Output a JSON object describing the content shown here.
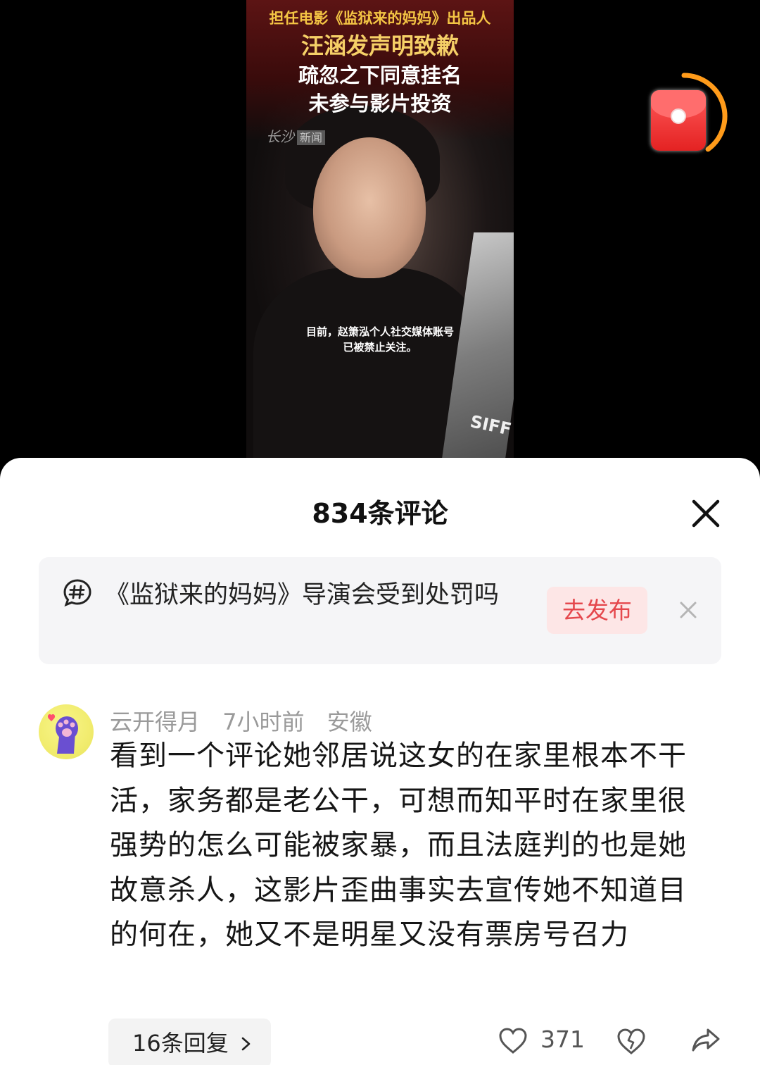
{
  "video": {
    "headline_sub": "担任电影《监狱来的妈妈》出品人",
    "headline_main": "汪涵发声明致歉",
    "headline_line2": "疏忽之下同意挂名",
    "headline_line3": "未参与影片投资",
    "logo_news": "新闻",
    "caption_line1": "目前，赵箫泓个人社交媒体账号",
    "caption_line2": "已被禁止关注。",
    "trophy_text": "SIFF",
    "red_packet_progress": 0.4,
    "accent_orange": "#ff9b1a"
  },
  "sheet": {
    "title": "834条评论",
    "close_icon": "close-icon"
  },
  "topic": {
    "icon": "hashtag-bubble-icon",
    "text": "《监狱来的妈妈》导演会受到处罚吗",
    "publish_label": "去发布",
    "accent": "#e5484d"
  },
  "comment": {
    "author": "云开得月",
    "time": "7小时前",
    "location": "安徽",
    "body": "看到一个评论她邻居说这女的在家里根本不干活，家务都是老公干，可想而知平时在家里很强势的怎么可能被家暴，而且法庭判的也是她故意杀人，这影片歪曲事实去宣传她不知道目的何在，她又不是明星又没有票房号召力",
    "replies_label": "16条回复",
    "like_count": "371"
  }
}
